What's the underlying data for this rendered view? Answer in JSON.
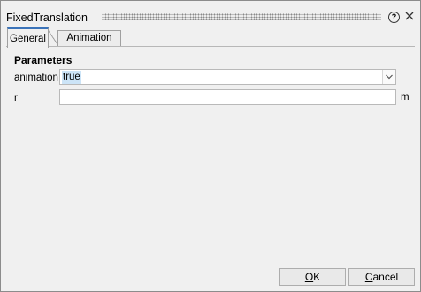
{
  "dialog": {
    "title": "FixedTranslation",
    "help_icon": "question-circle-icon",
    "close_icon": "close-x-icon"
  },
  "tabs": [
    {
      "label": "General",
      "selected": true
    },
    {
      "label": "Animation",
      "selected": false
    }
  ],
  "parameters": {
    "heading": "Parameters",
    "animation": {
      "label": "animation",
      "value": "true",
      "arrow_icon": "chevron-down-icon"
    },
    "r": {
      "label": "r",
      "value": "",
      "unit": "m"
    }
  },
  "buttons": {
    "ok": {
      "mnemonic": "O",
      "rest": "K"
    },
    "cancel": {
      "mnemonic": "C",
      "rest": "ancel"
    }
  },
  "colors": {
    "selected_tab_accent": "#3b73b9",
    "selection_highlight": "#cce4f7"
  }
}
